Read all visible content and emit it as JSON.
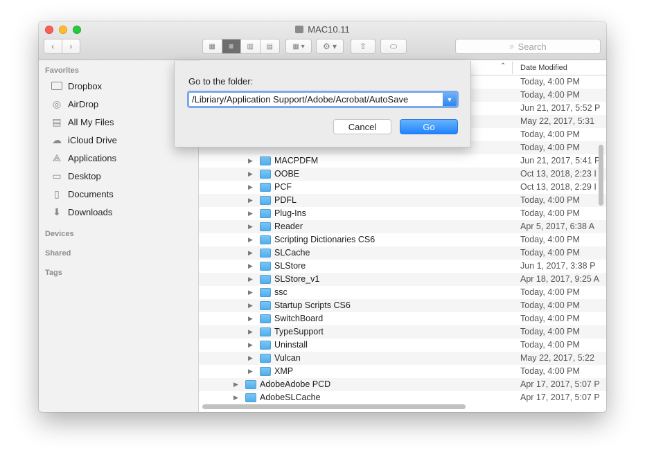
{
  "window": {
    "title": "MAC10.11"
  },
  "toolbar": {
    "search_placeholder": "Search"
  },
  "sidebar": {
    "favorites_label": "Favorites",
    "favorites": [
      {
        "label": "Dropbox",
        "icon": "folder-icon"
      },
      {
        "label": "AirDrop",
        "icon": "airdrop-icon"
      },
      {
        "label": "All My Files",
        "icon": "all-files-icon"
      },
      {
        "label": "iCloud Drive",
        "icon": "cloud-icon"
      },
      {
        "label": "Applications",
        "icon": "applications-icon"
      },
      {
        "label": "Desktop",
        "icon": "desktop-icon"
      },
      {
        "label": "Documents",
        "icon": "documents-icon"
      },
      {
        "label": "Downloads",
        "icon": "downloads-icon"
      }
    ],
    "devices_label": "Devices",
    "shared_label": "Shared",
    "tags_label": "Tags"
  },
  "columns": {
    "date_modified": "Date Modified"
  },
  "rows": [
    {
      "name": "",
      "date": "Today, 4:00 PM",
      "folder": false
    },
    {
      "name": "",
      "date": "Today, 4:00 PM",
      "folder": false
    },
    {
      "name": "",
      "date": "Jun 21, 2017, 5:52 P",
      "folder": false
    },
    {
      "name": "",
      "date": "May 22, 2017, 5:31",
      "folder": false
    },
    {
      "name": "",
      "date": "Today, 4:00 PM",
      "folder": false
    },
    {
      "name": "",
      "date": "Today, 4:00 PM",
      "folder": false
    },
    {
      "name": "MACPDFM",
      "date": "Jun 21, 2017, 5:41 P",
      "folder": true,
      "level": 2
    },
    {
      "name": "OOBE",
      "date": "Oct 13, 2018, 2:23 I",
      "folder": true,
      "level": 2
    },
    {
      "name": "PCF",
      "date": "Oct 13, 2018, 2:29 I",
      "folder": true,
      "level": 2
    },
    {
      "name": "PDFL",
      "date": "Today, 4:00 PM",
      "folder": true,
      "level": 2
    },
    {
      "name": "Plug-Ins",
      "date": "Today, 4:00 PM",
      "folder": true,
      "level": 2
    },
    {
      "name": "Reader",
      "date": "Apr 5, 2017, 6:38 A",
      "folder": true,
      "level": 2
    },
    {
      "name": "Scripting Dictionaries CS6",
      "date": "Today, 4:00 PM",
      "folder": true,
      "level": 2
    },
    {
      "name": "SLCache",
      "date": "Today, 4:00 PM",
      "folder": true,
      "level": 2
    },
    {
      "name": "SLStore",
      "date": "Jun 1, 2017, 3:38 P",
      "folder": true,
      "level": 2
    },
    {
      "name": "SLStore_v1",
      "date": "Apr 18, 2017, 9:25 A",
      "folder": true,
      "level": 2
    },
    {
      "name": "ssc",
      "date": "Today, 4:00 PM",
      "folder": true,
      "level": 2
    },
    {
      "name": "Startup Scripts CS6",
      "date": "Today, 4:00 PM",
      "folder": true,
      "level": 2
    },
    {
      "name": "SwitchBoard",
      "date": "Today, 4:00 PM",
      "folder": true,
      "level": 2
    },
    {
      "name": "TypeSupport",
      "date": "Today, 4:00 PM",
      "folder": true,
      "level": 2
    },
    {
      "name": "Uninstall",
      "date": "Today, 4:00 PM",
      "folder": true,
      "level": 2
    },
    {
      "name": "Vulcan",
      "date": "May 22, 2017, 5:22",
      "folder": true,
      "level": 2
    },
    {
      "name": "XMP",
      "date": "Today, 4:00 PM",
      "folder": true,
      "level": 2
    },
    {
      "name": "AdobeAdobe PCD",
      "date": "Apr 17, 2017, 5:07 P",
      "folder": true,
      "level": 1
    },
    {
      "name": "AdobeSLCache",
      "date": "Apr 17, 2017, 5:07 P",
      "folder": true,
      "level": 1
    }
  ],
  "dialog": {
    "label": "Go to the folder:",
    "path_value": "/Libriary/Application Support/Adobe/Acrobat/AutoSave",
    "cancel_label": "Cancel",
    "go_label": "Go"
  },
  "colors": {
    "accent": "#2f86ee",
    "folder": "#5eb6f0"
  }
}
